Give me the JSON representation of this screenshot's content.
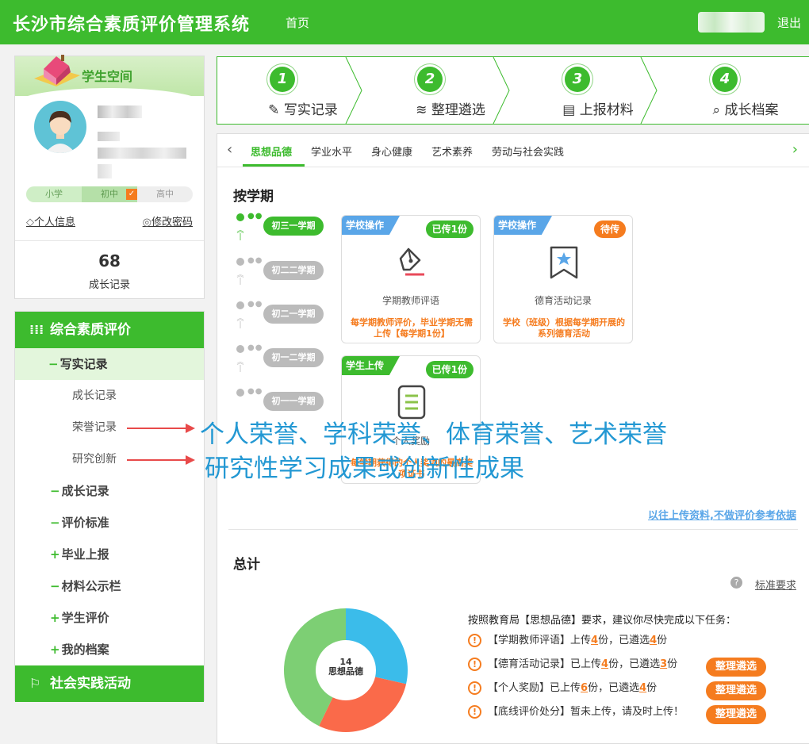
{
  "header": {
    "title": "长沙市综合素质评价管理系统",
    "home": "首页",
    "logout": "退出"
  },
  "profile": {
    "title": "学生空间",
    "stages": [
      "小学",
      "初中",
      "高中"
    ],
    "current_stage": "初中",
    "personal_info": "个人信息",
    "change_password": "修改密码",
    "growth_count": "68",
    "growth_label": "成长记录"
  },
  "menu": {
    "section_main": "综合素质评价",
    "writing_record": "写实记录",
    "sub_items": [
      "成长记录",
      "荣誉记录",
      "研究创新"
    ],
    "items": [
      {
        "sign": "−",
        "label": "成长记录"
      },
      {
        "sign": "−",
        "label": "评价标准"
      },
      {
        "sign": "+",
        "label": "毕业上报"
      },
      {
        "sign": "−",
        "label": "材料公示栏"
      },
      {
        "sign": "+",
        "label": "学生评价"
      },
      {
        "sign": "+",
        "label": "我的档案"
      }
    ],
    "section_social": "社会实践活动"
  },
  "steps": [
    {
      "num": "1",
      "label": "写实记录"
    },
    {
      "num": "2",
      "label": "整理遴选"
    },
    {
      "num": "3",
      "label": "上报材料"
    },
    {
      "num": "4",
      "label": "成长档案"
    }
  ],
  "tabs": [
    "思想品德",
    "学业水平",
    "身心健康",
    "艺术素养",
    "劳动与社会实践"
  ],
  "semester_title": "按学期",
  "terms": [
    "初三一学期",
    "初二二学期",
    "初二一学期",
    "初一二学期",
    "初一一学期"
  ],
  "cards": [
    {
      "type": "学校操作",
      "badge": "已传1份",
      "name": "学期教师评语",
      "desc": "每学期教师评价，毕业学期无需上传【每学期1份】",
      "icon": "pen-icon"
    },
    {
      "type": "学校操作",
      "badge": "待传",
      "name": "德育活动记录",
      "desc": "学校（班级）根据每学期开展的系列德育活动",
      "icon": "bookmark-star-icon"
    },
    {
      "type": "学生上传",
      "badge": "已传1份",
      "name": "个人奖励",
      "desc": "每学期获得的个人奖项的最高奖项证书",
      "icon": "document-list-icon"
    }
  ],
  "old_uploads_link": "以往上传资料,不做评价参考依据",
  "summary": {
    "title": "总计",
    "standard_link": "标准要求",
    "chart_center_num": "14",
    "chart_center_label": "思想品德",
    "intro": "按照教育局【思想品德】要求，建议你尽快完成以下任务：",
    "action_label": "整理遴选",
    "tasks": [
      {
        "name": "【学期教师评语】",
        "a": "上传",
        "n1": "4",
        "b": "份，已遴选",
        "n2": "4",
        "c": "份"
      },
      {
        "name": "【德育活动记录】",
        "a": "已上传",
        "n1": "4",
        "b": "份，已遴选",
        "n2": "3",
        "c": "份"
      },
      {
        "name": "【个人奖励】",
        "a": "已上传",
        "n1": "6",
        "b": "份，已遴选",
        "n2": "4",
        "c": "份"
      },
      {
        "name": "【底线评价处分】",
        "a": "暂未上传，请及时上传！",
        "n1": "",
        "b": "",
        "n2": "",
        "c": ""
      }
    ]
  },
  "chart_data": {
    "type": "pie",
    "values": [
      4,
      4,
      6
    ],
    "colors": [
      "#3bbcea",
      "#fa6a4a",
      "#7dcf74"
    ],
    "center_text": "14 思想品德"
  },
  "annotations": [
    "个人荣誉、学科荣誉、体育荣誉、艺术荣誉",
    "研究性学习成果或创新性成果"
  ]
}
